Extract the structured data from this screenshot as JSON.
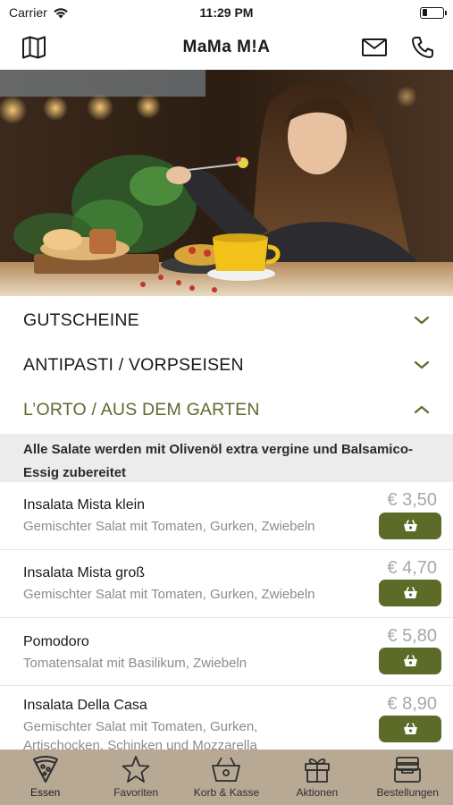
{
  "status_bar": {
    "carrier": "Carrier",
    "time": "11:29 PM",
    "battery_level": 0.25
  },
  "nav": {
    "title": "MaMa M!A",
    "left_icon": "map-icon",
    "right_icons": [
      "mail-icon",
      "phone-icon"
    ]
  },
  "categories": [
    {
      "label": "GUTSCHEINE",
      "expanded": false
    },
    {
      "label": "ANTIPASTI / VORPSEISEN",
      "expanded": false
    },
    {
      "label": "L’ORTO / AUS DEM GARTEN",
      "expanded": true
    }
  ],
  "notice": "Alle Salate werden mit Olivenöl extra vergine und Balsamico-Essig zubereitet",
  "products": [
    {
      "name": "Insalata Mista klein",
      "description": "Gemischter Salat mit Tomaten, Gurken, Zwiebeln",
      "price": "€ 3,50"
    },
    {
      "name": "Insalata Mista groß",
      "description": "Gemischter Salat mit Tomaten, Gurken, Zwiebeln",
      "price": "€ 4,70"
    },
    {
      "name": "Pomodoro",
      "description": "Tomatensalat mit Basilikum, Zwiebeln",
      "price": "€ 5,80"
    },
    {
      "name": "Insalata Della Casa",
      "description": "Gemischter Salat mit Tomaten, Gurken, Artischocken, Schinken und Mozzarella",
      "price": "€ 8,90"
    }
  ],
  "tabs": [
    {
      "label": "Essen",
      "icon": "pizza-icon",
      "active": true
    },
    {
      "label": "Favoriten",
      "icon": "star-icon",
      "active": false
    },
    {
      "label": "Korb & Kasse",
      "icon": "basket-icon",
      "active": false
    },
    {
      "label": "Aktionen",
      "icon": "gift-icon",
      "active": false
    },
    {
      "label": "Bestellungen",
      "icon": "inbox-icon",
      "active": false
    }
  ],
  "colors": {
    "accent": "#5d6b28",
    "tab_bar": "#b8a995",
    "price": "#a8a8a8"
  }
}
